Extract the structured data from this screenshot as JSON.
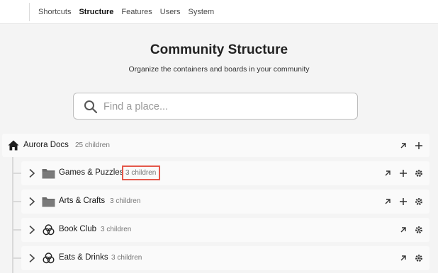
{
  "nav": {
    "items": [
      {
        "label": "Shortcuts",
        "active": false
      },
      {
        "label": "Structure",
        "active": true
      },
      {
        "label": "Features",
        "active": false
      },
      {
        "label": "Users",
        "active": false
      },
      {
        "label": "System",
        "active": false
      }
    ]
  },
  "page": {
    "title": "Community Structure",
    "subtitle": "Organize the containers and boards in your community"
  },
  "search": {
    "placeholder": "Find a place...",
    "value": ""
  },
  "tree": {
    "root": {
      "name": "Aurora Docs",
      "count": "25 children",
      "icon": "home-icon"
    },
    "items": [
      {
        "name": "Games & Puzzles",
        "count": "3 children",
        "icon": "folder-icon",
        "highlighted": true
      },
      {
        "name": "Arts & Crafts",
        "count": "3 children",
        "icon": "folder-icon",
        "highlighted": false
      },
      {
        "name": "Book Club",
        "count": "3 children",
        "icon": "group-hub-icon",
        "highlighted": false
      },
      {
        "name": "Eats & Drinks",
        "count": "3 children",
        "icon": "group-hub-icon",
        "highlighted": false
      }
    ]
  },
  "colors": {
    "highlight": "#e4574a",
    "background": "#f4f4f4",
    "row": "#fafafa",
    "muted": "#777777"
  }
}
